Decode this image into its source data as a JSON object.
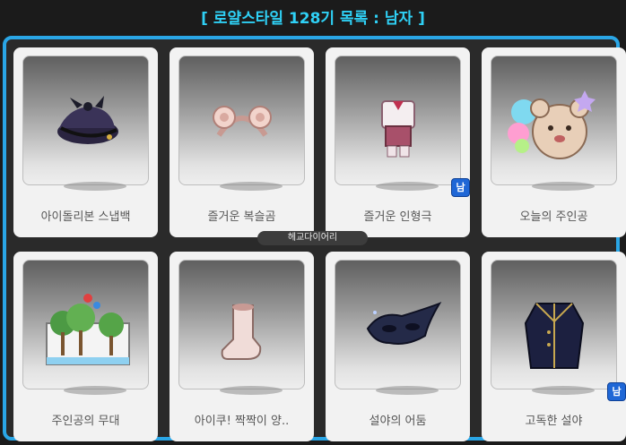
{
  "title": "[ 로얄스타일 128기 목록 : 남자 ]",
  "items": [
    {
      "label": "아이돌리본 스냅백",
      "badge": ""
    },
    {
      "label": "즐거운 복슬곰",
      "badge": ""
    },
    {
      "label": "즐거운 인형극",
      "badge": "남"
    },
    {
      "label": "오늘의 주인공",
      "badge": ""
    },
    {
      "label": "주인공의 무대",
      "badge": ""
    },
    {
      "label": "아이쿠! 짝짝이 양..",
      "badge": ""
    },
    {
      "label": "설야의 어둠",
      "badge": ""
    },
    {
      "label": "고독한 설야",
      "badge": "남"
    }
  ],
  "watermark": "헤교다이어리",
  "colors": {
    "accent": "#2aa6e6",
    "title": "#2fd0f5",
    "badge": "#1f67d6"
  }
}
